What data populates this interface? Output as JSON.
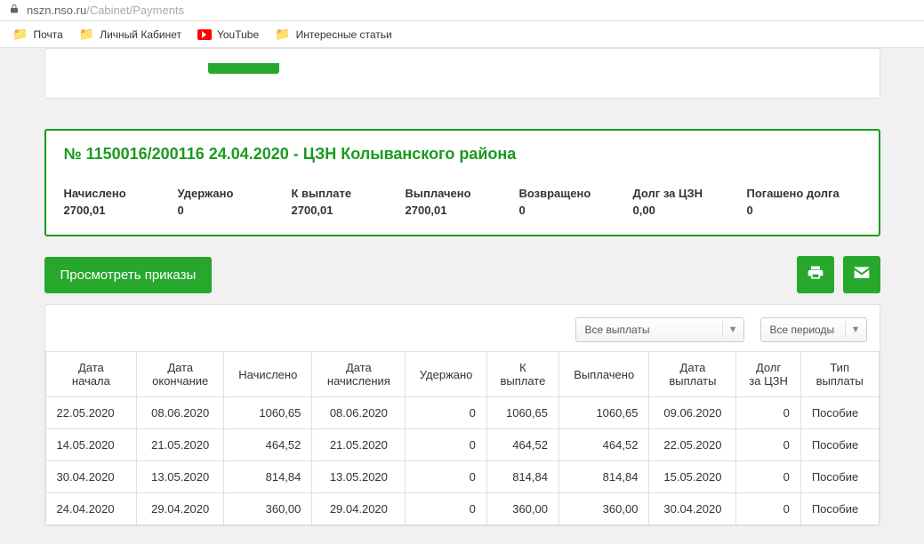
{
  "browser": {
    "url_host": "nszn.nso.ru",
    "url_path": "/Cabinet/Payments"
  },
  "bookmarks": [
    {
      "label": "Почта",
      "icon": "folder"
    },
    {
      "label": "Личный Кабинет",
      "icon": "folder"
    },
    {
      "label": "YouTube",
      "icon": "youtube"
    },
    {
      "label": "Интересные статьи",
      "icon": "folder"
    }
  ],
  "summary": {
    "title": "№ 1150016/200116 24.04.2020 - ЦЗН Колыванского района",
    "items": [
      {
        "label": "Начислено",
        "value": "2700,01"
      },
      {
        "label": "Удержано",
        "value": "0"
      },
      {
        "label": "К выплате",
        "value": "2700,01"
      },
      {
        "label": "Выплачено",
        "value": "2700,01"
      },
      {
        "label": "Возвращено",
        "value": "0"
      },
      {
        "label": "Долг за ЦЗН",
        "value": "0,00"
      },
      {
        "label": "Погашено долга",
        "value": "0"
      }
    ]
  },
  "actions": {
    "view_orders": "Просмотреть приказы"
  },
  "filters": {
    "payments_dd": "Все выплаты",
    "periods_dd": "Все периоды"
  },
  "table": {
    "headers": [
      "Дата начала",
      "Дата окончание",
      "Начислено",
      "Дата начисления",
      "Удержано",
      "К выплате",
      "Выплачено",
      "Дата выплаты",
      "Долг за ЦЗН",
      "Тип выплаты"
    ],
    "rows": [
      {
        "start": "22.05.2020",
        "end": "08.06.2020",
        "accrued": "1060,65",
        "accrual_date": "08.06.2020",
        "withheld": "0",
        "to_pay": "1060,65",
        "paid": "1060,65",
        "pay_date": "09.06.2020",
        "debt": "0",
        "type": "Пособие"
      },
      {
        "start": "14.05.2020",
        "end": "21.05.2020",
        "accrued": "464,52",
        "accrual_date": "21.05.2020",
        "withheld": "0",
        "to_pay": "464,52",
        "paid": "464,52",
        "pay_date": "22.05.2020",
        "debt": "0",
        "type": "Пособие"
      },
      {
        "start": "30.04.2020",
        "end": "13.05.2020",
        "accrued": "814,84",
        "accrual_date": "13.05.2020",
        "withheld": "0",
        "to_pay": "814,84",
        "paid": "814,84",
        "pay_date": "15.05.2020",
        "debt": "0",
        "type": "Пособие"
      },
      {
        "start": "24.04.2020",
        "end": "29.04.2020",
        "accrued": "360,00",
        "accrual_date": "29.04.2020",
        "withheld": "0",
        "to_pay": "360,00",
        "paid": "360,00",
        "pay_date": "30.04.2020",
        "debt": "0",
        "type": "Пособие"
      }
    ]
  }
}
